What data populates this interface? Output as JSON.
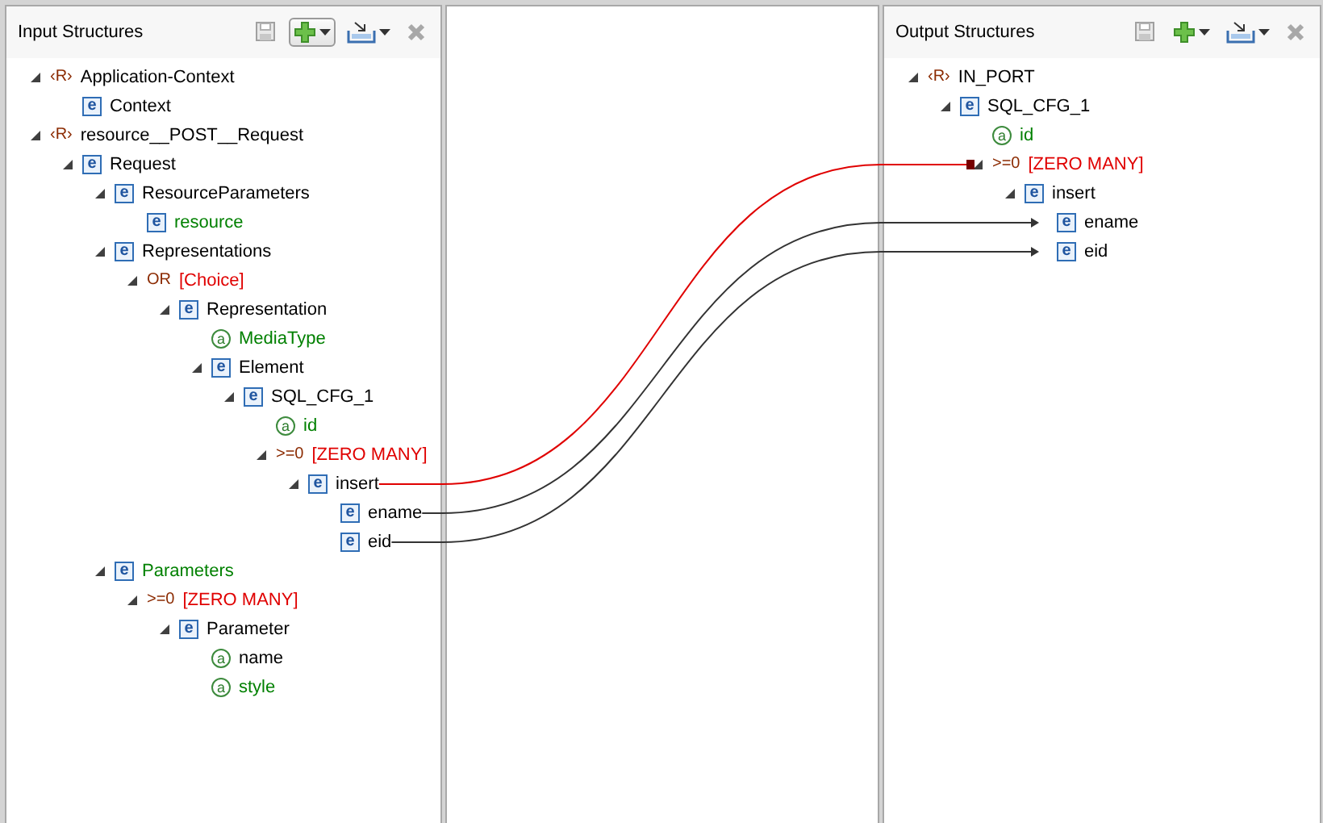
{
  "input_panel": {
    "title": "Input Structures",
    "toolbar": [
      {
        "kind": "save",
        "highlighted": false
      },
      {
        "kind": "add",
        "highlighted": true
      },
      {
        "kind": "import",
        "highlighted": false
      },
      {
        "kind": "close",
        "highlighted": false
      }
    ],
    "tree": [
      {
        "kind": "root",
        "badge": "‹R›",
        "label": "Application-Context",
        "expanded": true,
        "children": [
          {
            "kind": "element",
            "badge": "e",
            "label": "Context"
          }
        ]
      },
      {
        "kind": "root",
        "badge": "‹R›",
        "label": "resource__POST__Request",
        "expanded": true,
        "children": [
          {
            "kind": "element",
            "badge": "e",
            "label": "Request",
            "expanded": true,
            "children": [
              {
                "kind": "element",
                "badge": "e",
                "label": "ResourceParameters",
                "expanded": true,
                "children": [
                  {
                    "kind": "element",
                    "badge": "e",
                    "label": "resource",
                    "color": "#008000"
                  }
                ]
              },
              {
                "kind": "element",
                "badge": "e",
                "label": "Representations",
                "expanded": true,
                "children": [
                  {
                    "kind": "choice",
                    "badge": "OR",
                    "label": "[Choice]",
                    "expanded": true,
                    "children": [
                      {
                        "kind": "element",
                        "badge": "e",
                        "label": "Representation",
                        "expanded": true,
                        "children": [
                          {
                            "kind": "attribute",
                            "badge": "a",
                            "label": "MediaType",
                            "color": "#008000"
                          },
                          {
                            "kind": "element",
                            "badge": "e",
                            "label": "Element",
                            "expanded": true,
                            "children": [
                              {
                                "kind": "element",
                                "badge": "e",
                                "label": "SQL_CFG_1",
                                "expanded": true,
                                "children": [
                                  {
                                    "kind": "attribute",
                                    "badge": "a",
                                    "label": "id",
                                    "color": "#008000"
                                  },
                                  {
                                    "kind": "cardinality",
                                    "badge": ">=0",
                                    "label": "[ZERO MANY]",
                                    "expanded": true,
                                    "children": [
                                      {
                                        "kind": "element",
                                        "badge": "e",
                                        "label": "insert",
                                        "mapped": true,
                                        "expanded": true,
                                        "children": [
                                          {
                                            "kind": "element",
                                            "badge": "e",
                                            "label": "ename",
                                            "mapped": true
                                          },
                                          {
                                            "kind": "element",
                                            "badge": "e",
                                            "label": "eid",
                                            "mapped": true
                                          }
                                        ]
                                      }
                                    ]
                                  }
                                ]
                              }
                            ]
                          }
                        ]
                      }
                    ]
                  }
                ]
              },
              {
                "kind": "element",
                "badge": "e",
                "label": "Parameters",
                "color": "#008000",
                "expanded": true,
                "children": [
                  {
                    "kind": "cardinality",
                    "badge": ">=0",
                    "label": "[ZERO MANY]",
                    "expanded": true,
                    "children": [
                      {
                        "kind": "element",
                        "badge": "e",
                        "label": "Parameter",
                        "expanded": true,
                        "children": [
                          {
                            "kind": "attribute",
                            "badge": "a",
                            "label": "name"
                          },
                          {
                            "kind": "attribute",
                            "badge": "a",
                            "label": "style",
                            "color": "#008000"
                          }
                        ]
                      }
                    ]
                  }
                ]
              }
            ]
          }
        ]
      }
    ]
  },
  "output_panel": {
    "title": "Output Structures",
    "toolbar": [
      {
        "kind": "save",
        "highlighted": false
      },
      {
        "kind": "add",
        "highlighted": false
      },
      {
        "kind": "import",
        "highlighted": false
      },
      {
        "kind": "close",
        "highlighted": false
      }
    ],
    "tree": [
      {
        "kind": "root",
        "badge": "‹R›",
        "label": "IN_PORT",
        "expanded": true,
        "children": [
          {
            "kind": "element",
            "badge": "e",
            "label": "SQL_CFG_1",
            "expanded": true,
            "children": [
              {
                "kind": "attribute",
                "badge": "a",
                "label": "id",
                "color": "#008000"
              },
              {
                "kind": "cardinality",
                "badge": ">=0",
                "label": "[ZERO MANY]",
                "mapped": true,
                "expanded": true,
                "children": [
                  {
                    "kind": "element",
                    "badge": "e",
                    "label": "insert",
                    "expanded": true,
                    "children": [
                      {
                        "kind": "element",
                        "badge": "e",
                        "label": "ename",
                        "mapped": true
                      },
                      {
                        "kind": "element",
                        "badge": "e",
                        "label": "eid",
                        "mapped": true
                      }
                    ]
                  }
                ]
              }
            ]
          }
        ]
      }
    ]
  },
  "mappings": [
    {
      "selected": true
    },
    {
      "selected": false
    },
    {
      "selected": false
    }
  ]
}
